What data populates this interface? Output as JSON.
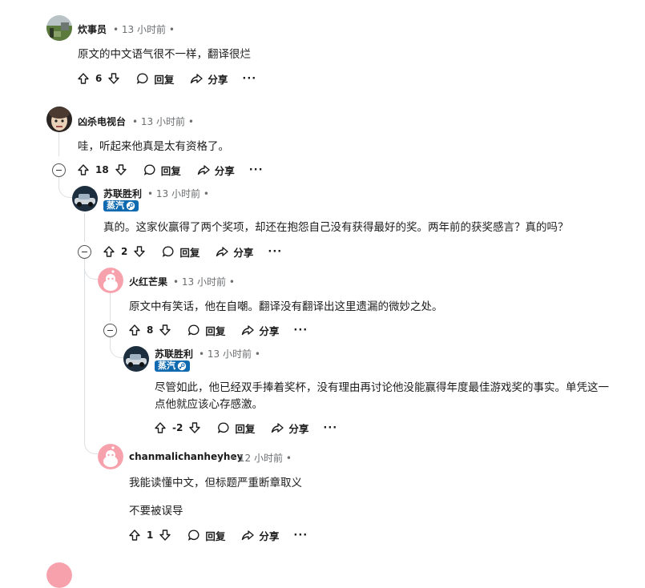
{
  "colors": {
    "badge_bg": "#0f6ab0",
    "thread_line": "#dcdfe2",
    "meta_text": "#6b6e70"
  },
  "actions": {
    "reply_label": "回复",
    "share_label": "分享",
    "more_label": "···"
  },
  "comments": [
    {
      "author": "炊事员",
      "time": "13 小时前",
      "text": "原文的中文语气很不一样，翻译很烂",
      "votes": "6"
    },
    {
      "author": "凶杀电视台",
      "time": "13 小时前",
      "text": "哇，听起来他真是太有资格了。",
      "votes": "18"
    },
    {
      "author": "苏联胜利",
      "flair": "蒸汽",
      "time": "13 小时前",
      "text": "真的。这家伙赢得了两个奖项，却还在抱怨自己没有获得最好的奖。两年前的获奖感言？真的吗？",
      "votes": "2"
    },
    {
      "author": "火红芒果",
      "time": "13 小时前",
      "text": "原文中有笑话，他在自嘲。翻译没有翻译出这里遗漏的微妙之处。",
      "votes": "8"
    },
    {
      "author": "苏联胜利",
      "flair": "蒸汽",
      "time": "13 小时前",
      "text_line1": "尽管如此，他已经双手捧着奖杯，没有理由再讨论他没能赢得年度最佳游戏奖的事实。单凭这一",
      "text_line2": "点他就应该心存感激。",
      "votes": "-2"
    },
    {
      "author": "chanmalichanheyhey",
      "time": "12 小时前",
      "text_line1": "我能读懂中文，但标题严重断章取义",
      "text_line2": "不要被误导",
      "votes": "1"
    }
  ]
}
